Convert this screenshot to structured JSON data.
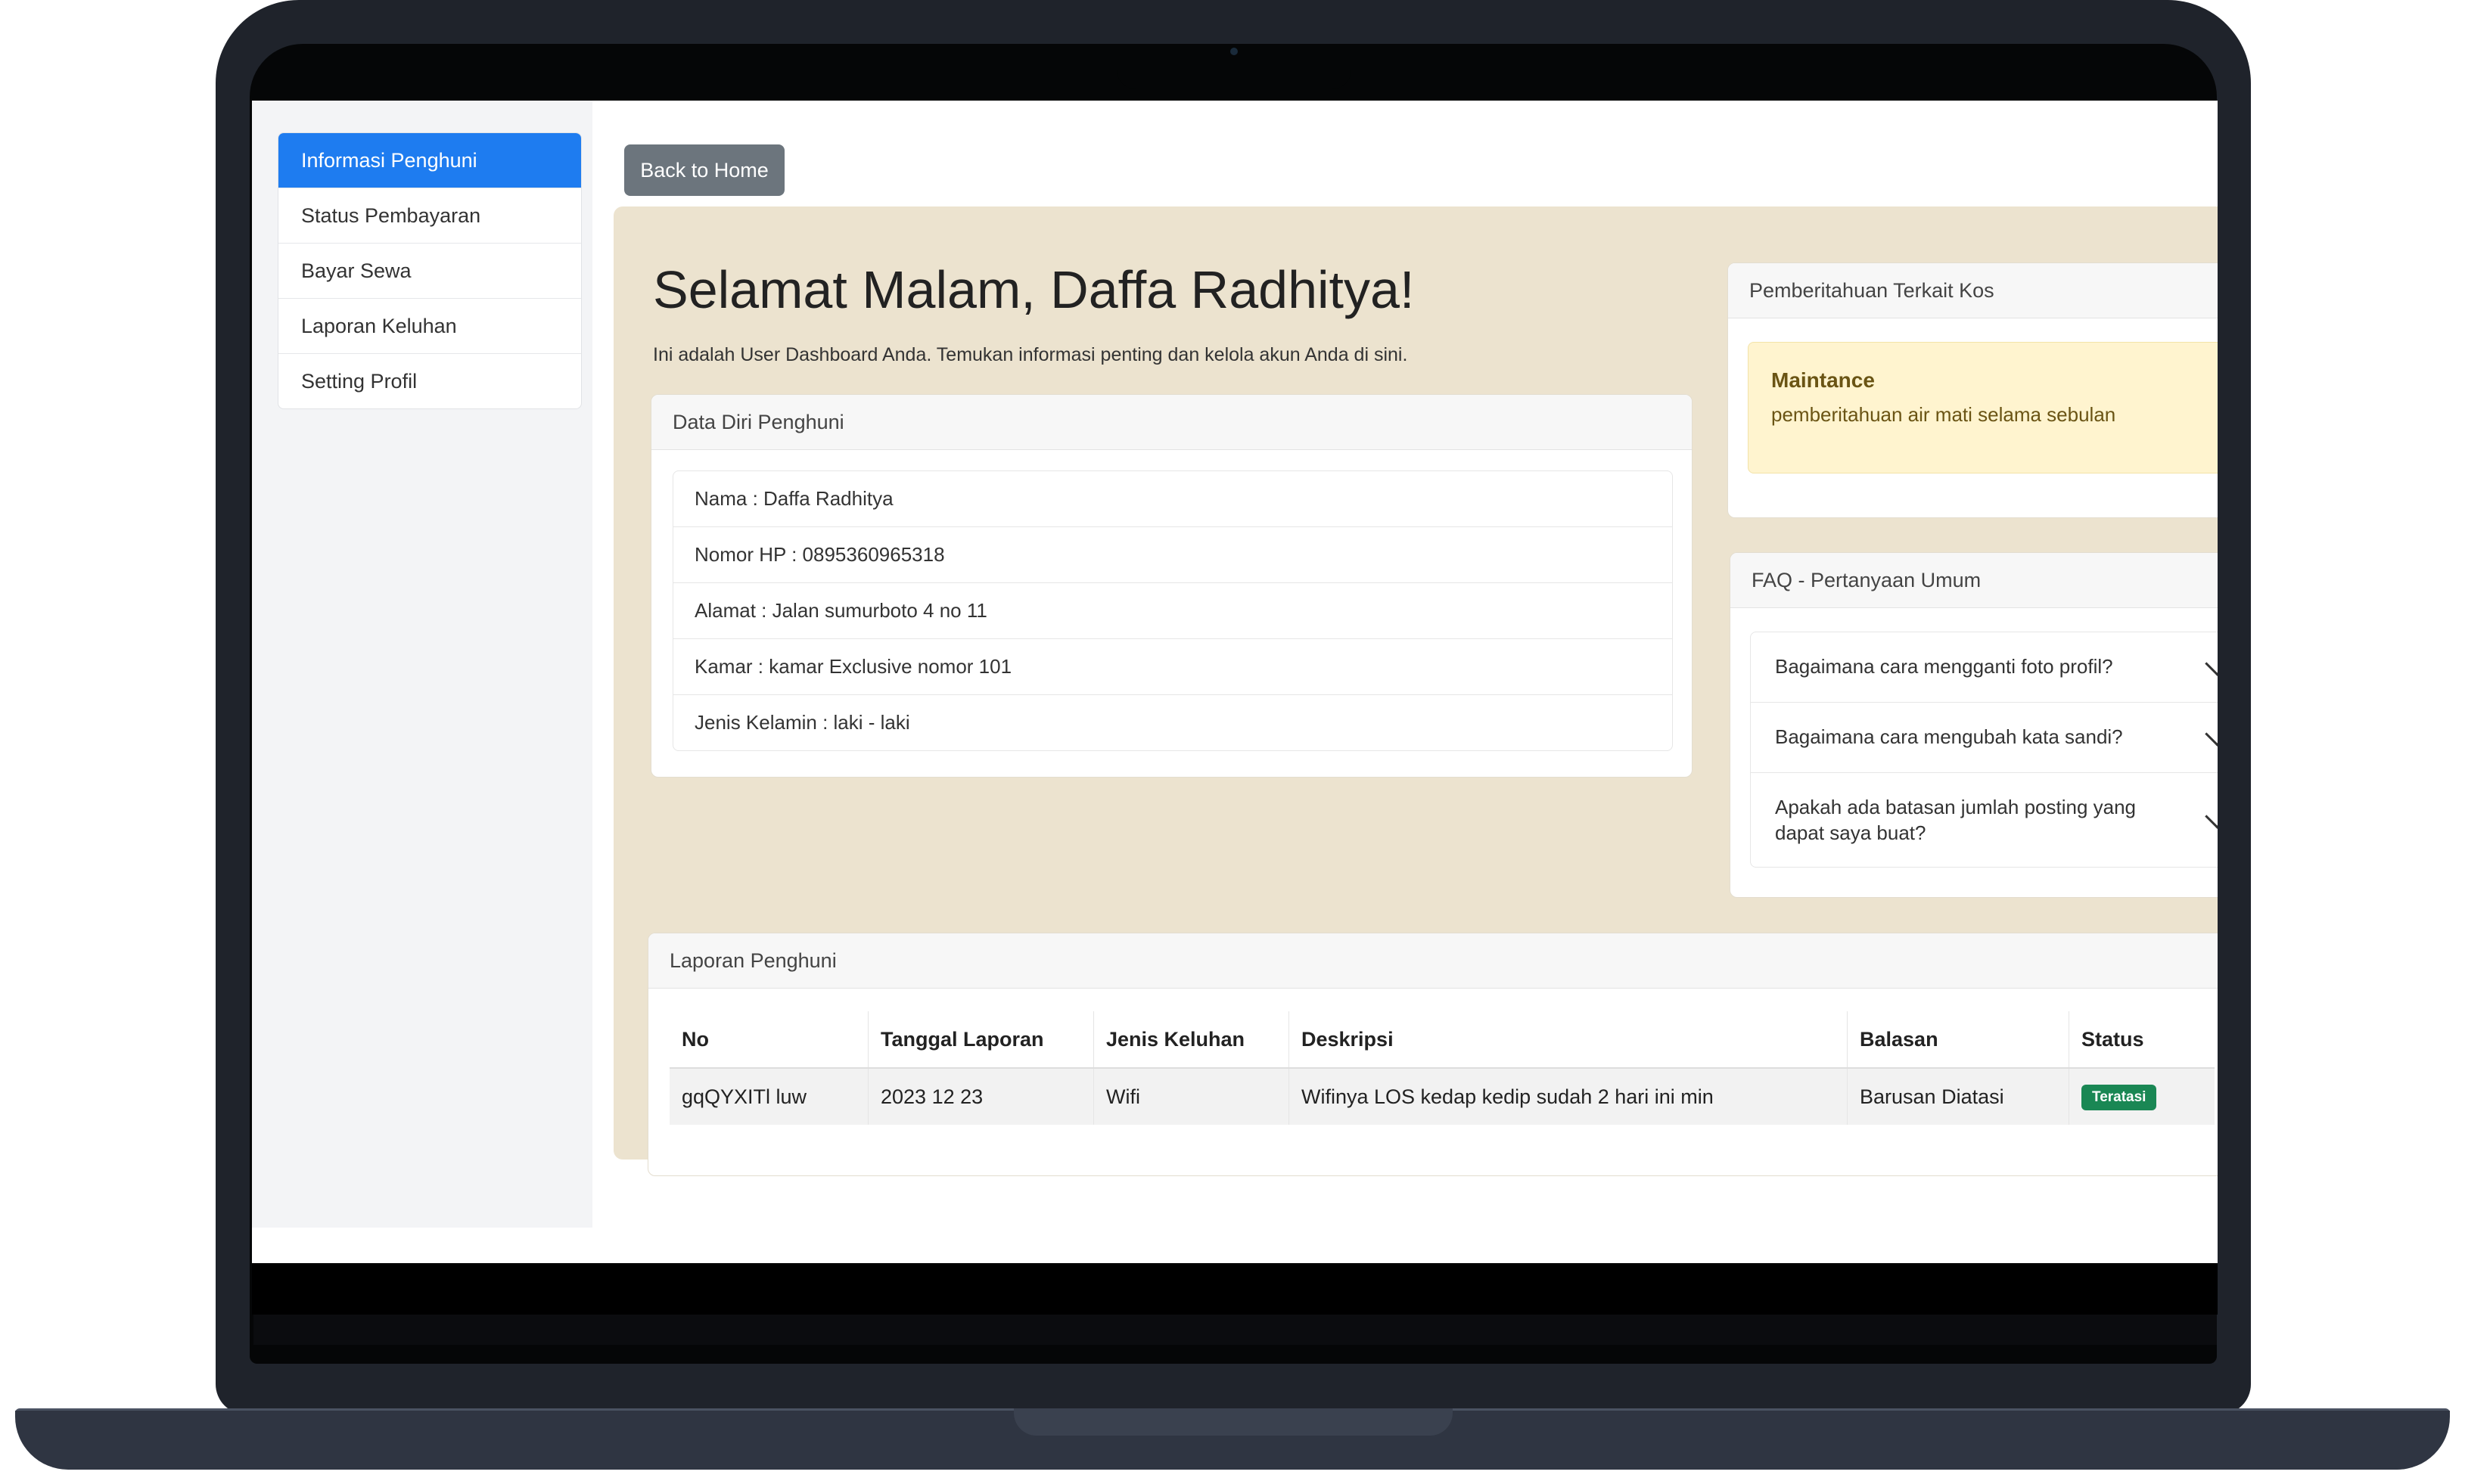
{
  "sidebar": {
    "items": [
      {
        "label": "Informasi Penghuni",
        "active": true
      },
      {
        "label": "Status Pembayaran"
      },
      {
        "label": "Bayar Sewa"
      },
      {
        "label": "Laporan Keluhan"
      },
      {
        "label": "Setting Profil"
      }
    ]
  },
  "header": {
    "back_label": "Back to Home",
    "greeting": "Selamat Malam, Daffa Radhitya!",
    "subtitle": "Ini adalah User Dashboard Anda. Temukan informasi penting dan kelola akun Anda di sini."
  },
  "profile": {
    "title": "Data Diri Penghuni",
    "rows": [
      "Nama : Daffa Radhitya",
      "Nomor HP : 0895360965318",
      "Alamat : Jalan sumurboto 4 no 11",
      "Kamar : kamar Exclusive nomor 101",
      "Jenis Kelamin : laki - laki"
    ]
  },
  "notifications": {
    "title": "Pemberitahuan Terkait Kos",
    "alert_title": "Maintance",
    "alert_text": "pemberitahuan air mati selama sebulan"
  },
  "faq": {
    "title": "FAQ - Pertanyaan Umum",
    "items": [
      "Bagaimana cara mengganti foto profil?",
      "Bagaimana cara mengubah kata sandi?",
      "Apakah ada batasan jumlah posting yang dapat saya buat?"
    ]
  },
  "reports": {
    "title": "Laporan Penghuni",
    "columns": [
      "No",
      "Tanggal Laporan",
      "Jenis Keluhan",
      "Deskripsi",
      "Balasan",
      "Status"
    ],
    "rows": [
      {
        "no": "gqQYXITl luw",
        "date": "2023 12 23",
        "type": "Wifi",
        "desc": "Wifinya LOS kedap kedip sudah 2 hari ini min",
        "reply": "Barusan Diatasi",
        "status": "Teratasi"
      }
    ]
  },
  "colors": {
    "accent": "#1e7cf0",
    "panel": "#ece3cf",
    "alert_bg": "#fff4cf",
    "status_success": "#1a8754"
  }
}
